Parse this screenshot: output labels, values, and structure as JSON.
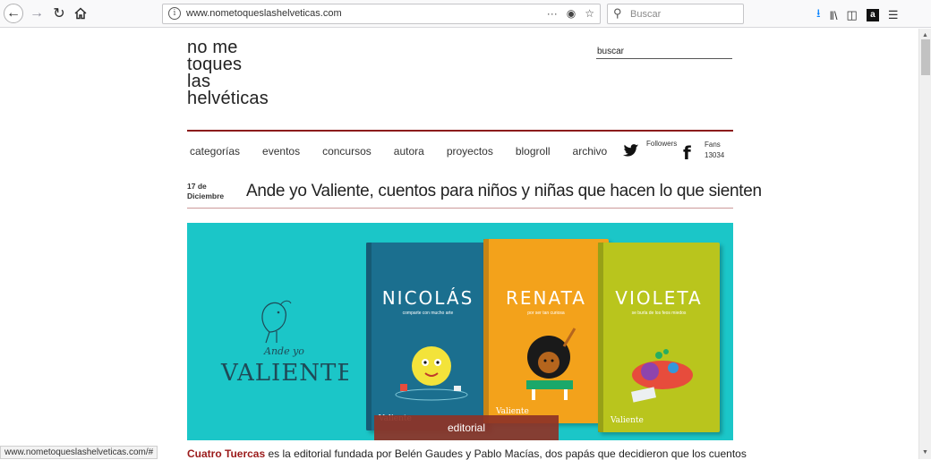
{
  "browser": {
    "url": "www.nometoqueslashelveticas.com",
    "search_placeholder": "Buscar",
    "status_url": "www.nometoqueslashelveticas.com/#"
  },
  "site": {
    "logo_lines": [
      "no me",
      "toques",
      "las",
      "helvéticas"
    ],
    "search_placeholder": "buscar",
    "menu": [
      "categorías",
      "eventos",
      "concursos",
      "autora",
      "proyectos",
      "blogroll",
      "archivo"
    ],
    "twitter_label": "Followers",
    "facebook_label": "Fans",
    "facebook_count": "13034"
  },
  "post": {
    "date_day": "17 de",
    "date_month": "Diciembre",
    "title": "Ande yo Valiente, cuentos para niños y niñas que hacen lo que sienten",
    "hero": {
      "brand_line1": "Ande yo",
      "brand_line2": "VALIENTE",
      "books": [
        {
          "title": "NICOLÁS",
          "subtitle": "comparte con mucho arte"
        },
        {
          "title": "RENATA",
          "subtitle": "por ser tan curiosa"
        },
        {
          "title": "VIOLETA",
          "subtitle": "se burla de los feos miedos"
        }
      ],
      "book_logo": "Valiente",
      "caption": "editorial"
    },
    "body_link": "Cuatro Tuercas",
    "body_text": " es la editorial fundada por Belén Gaudes y Pablo Macías, dos papás que decidieron que los cuentos"
  },
  "colors": {
    "accent_red": "#8c1c1c",
    "hero_bg": "#1bc6c8",
    "book_blue": "#1b6f8f",
    "book_orange": "#f3a21b",
    "book_green": "#b9c51d"
  }
}
